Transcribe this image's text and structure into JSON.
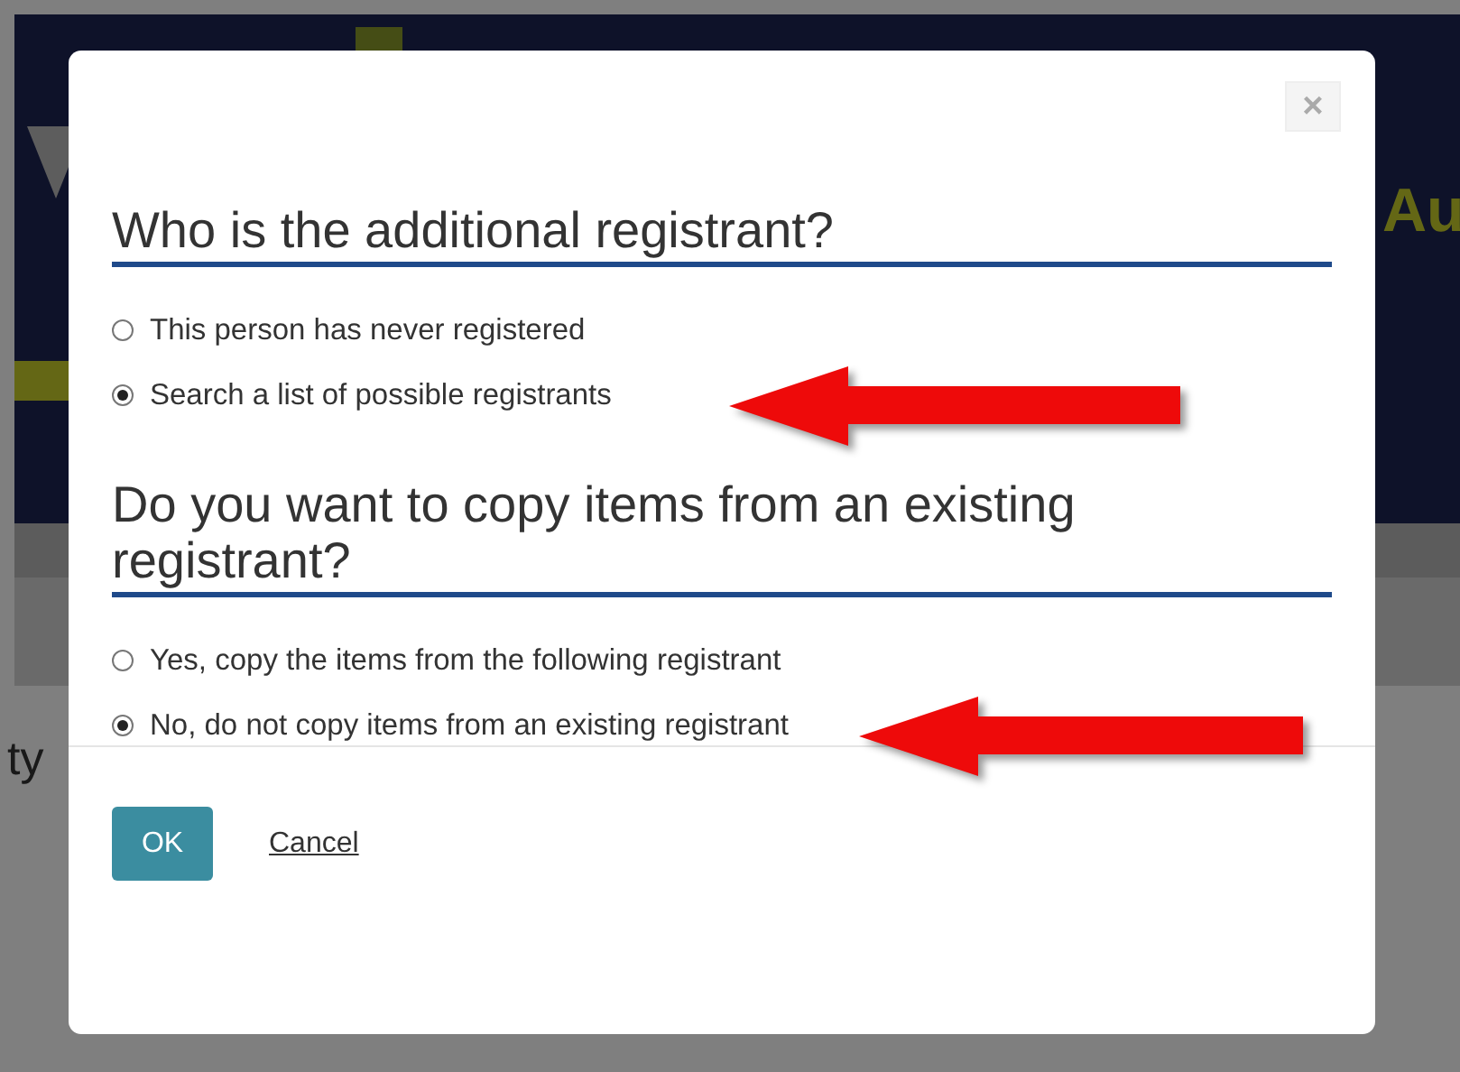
{
  "background": {
    "header_text": "Au",
    "page_text": "ty"
  },
  "dialog": {
    "close": "×",
    "sections": [
      {
        "heading": "Who is the additional registrant?",
        "options": [
          {
            "label": "This person has never registered",
            "selected": false
          },
          {
            "label": "Search a list of possible registrants",
            "selected": true
          }
        ]
      },
      {
        "heading": "Do you want to copy items from an existing registrant?",
        "options": [
          {
            "label": "Yes, copy the items from the following registrant",
            "selected": false
          },
          {
            "label": "No, do not copy items from an existing registrant",
            "selected": true
          }
        ]
      }
    ],
    "buttons": {
      "ok": "OK",
      "cancel": "Cancel"
    }
  }
}
